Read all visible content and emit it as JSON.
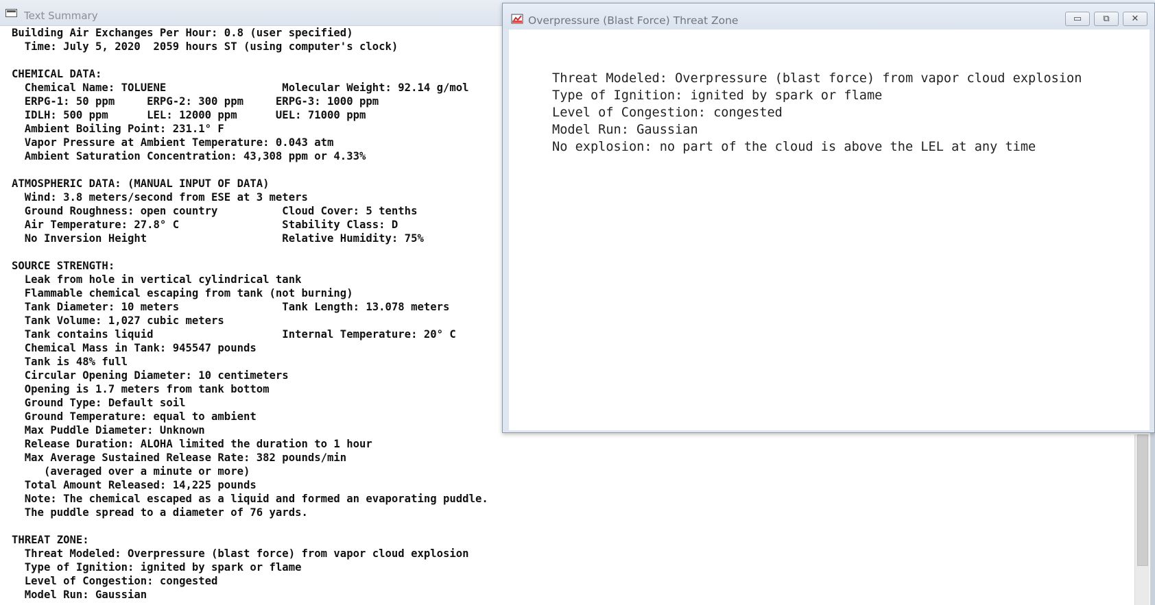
{
  "summary_window": {
    "title": "Text Summary",
    "text": "Building Air Exchanges Per Hour: 0.8 (user specified)\n  Time: July 5, 2020  2059 hours ST (using computer's clock)\n\nCHEMICAL DATA:\n  Chemical Name: TOLUENE                  Molecular Weight: 92.14 g/mol\n  ERPG-1: 50 ppm     ERPG-2: 300 ppm     ERPG-3: 1000 ppm\n  IDLH: 500 ppm      LEL: 12000 ppm      UEL: 71000 ppm\n  Ambient Boiling Point: 231.1° F\n  Vapor Pressure at Ambient Temperature: 0.043 atm\n  Ambient Saturation Concentration: 43,308 ppm or 4.33%\n\nATMOSPHERIC DATA: (MANUAL INPUT OF DATA)\n  Wind: 3.8 meters/second from ESE at 3 meters\n  Ground Roughness: open country          Cloud Cover: 5 tenths\n  Air Temperature: 27.8° C                Stability Class: D\n  No Inversion Height                     Relative Humidity: 75%\n\nSOURCE STRENGTH:\n  Leak from hole in vertical cylindrical tank\n  Flammable chemical escaping from tank (not burning)\n  Tank Diameter: 10 meters                Tank Length: 13.078 meters\n  Tank Volume: 1,027 cubic meters\n  Tank contains liquid                    Internal Temperature: 20° C\n  Chemical Mass in Tank: 945547 pounds\n  Tank is 48% full\n  Circular Opening Diameter: 10 centimeters\n  Opening is 1.7 meters from tank bottom\n  Ground Type: Default soil\n  Ground Temperature: equal to ambient\n  Max Puddle Diameter: Unknown\n  Release Duration: ALOHA limited the duration to 1 hour\n  Max Average Sustained Release Rate: 382 pounds/min\n     (averaged over a minute or more)\n  Total Amount Released: 14,225 pounds\n  Note: The chemical escaped as a liquid and formed an evaporating puddle.\n  The puddle spread to a diameter of 76 yards.\n\nTHREAT ZONE:\n  Threat Modeled: Overpressure (blast force) from vapor cloud explosion\n  Type of Ignition: ignited by spark or flame\n  Level of Congestion: congested\n  Model Run: Gaussian"
  },
  "threat_window": {
    "title": "Overpressure (Blast Force) Threat Zone",
    "controls": {
      "minimize": "▭",
      "maximize": "⧉",
      "close": "✕"
    },
    "text": "Threat Modeled: Overpressure (blast force) from vapor cloud explosion\nType of Ignition: ignited by spark or flame\nLevel of Congestion: congested\nModel Run: Gaussian\nNo explosion: no part of the cloud is above the LEL at any time"
  }
}
